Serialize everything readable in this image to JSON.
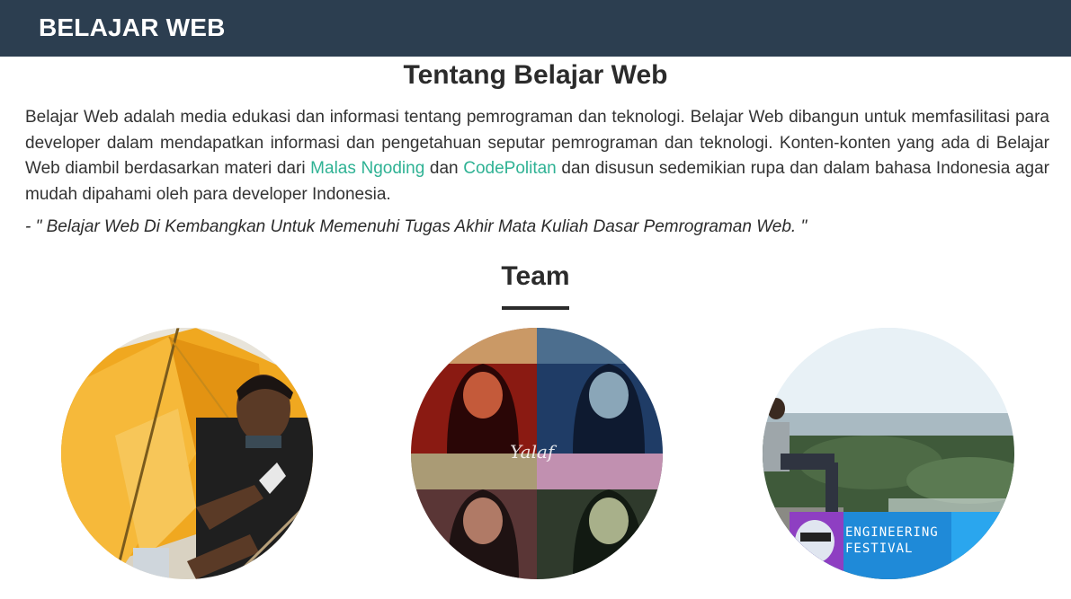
{
  "navbar": {
    "brand": "BELAJAR WEB"
  },
  "about": {
    "title": "Tentang Belajar Web",
    "text_part1": "Belajar Web adalah media edukasi dan informasi tentang pemrograman dan teknologi. Belajar Web dibangun untuk memfasilitasi para developer dalam mendapatkan informasi dan pengetahuan seputar pemrograman dan teknologi. Konten-konten yang ada di Belajar Web diambil berdasarkan materi dari ",
    "link1": "Malas Ngoding",
    "text_part2": " dan ",
    "link2": "CodePolitan",
    "text_part3": " dan disusun sedemikian rupa dan dalam bahasa Indonesia agar mudah dipahami oleh para developer Indonesia.",
    "quote": "- \" Belajar Web Di Kembangkan Untuk Memenuhi Tugas Akhir Mata Kuliah Dasar Pemrograman Web. \""
  },
  "team": {
    "title": "Team",
    "photo2_signature": "Yalaf",
    "photo3_banner_line1": "ENGINEERING",
    "photo3_banner_line2": "FESTIVAL"
  },
  "colors": {
    "navbar_bg": "#2c3e50",
    "link": "#2fb294",
    "heading": "#2b2b2b"
  }
}
